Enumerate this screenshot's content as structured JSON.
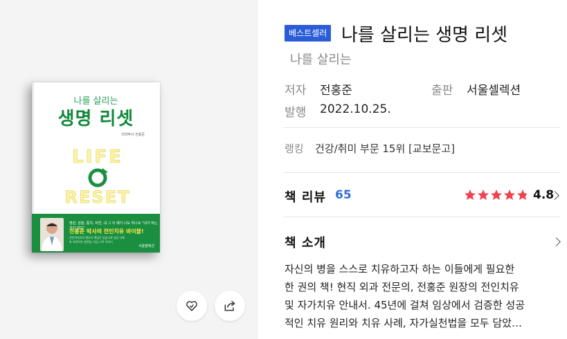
{
  "cover": {
    "subtitle": "나를 살리는",
    "title": "생명 리셋",
    "author": "의학박사 전홍준",
    "graphic_words": [
      "LIFE",
      "RESET"
    ],
    "band_intro": "영원, 암을, 통치, 자연, 내 그 이 얘기 나도 하나요 \"내가 하는 것이 쉽다\"",
    "band_headline": "전홍준 박사의 전인치유 바이블!",
    "band_detail": "전인적치유의 열쇠가 해답은 있습니까 임상 사례와 자연치유 실천법, 지금 시작 이야기",
    "publisher": "서울셀렉션"
  },
  "actions": {
    "like_icon": "heart-icon",
    "share_icon": "share-icon"
  },
  "product": {
    "badge": "베스트셀러",
    "title": "나를 살리는 생명 리셋",
    "subtitle": "나를 살리는",
    "author_label": "저자",
    "author": "전홍준",
    "publisher_label": "출판",
    "publisher": "서울셀렉션",
    "date_label": "발행",
    "date": "2022.10.25.",
    "ranking_label": "랭킹",
    "ranking": "건강/취미 부문 15위 [교보문고]"
  },
  "review": {
    "label": "책 리뷰",
    "count": "65",
    "rating": "4.8",
    "stars": 4.8,
    "star_color": "#f0434f"
  },
  "introduction": {
    "label": "책 소개",
    "lines": [
      "자신의 병을 스스로 치유하고자 하는 이들에게 필요한",
      "한 권의 책! 현직 외과 전문의, 전홍준 원장의 전인치유",
      "및 자가치유 안내서. 45년에 걸쳐 임상에서 검증한 성공",
      "적인 치유 원리와 치유 사례, 자가실천법을 모두 담았…"
    ]
  },
  "colors": {
    "accent_blue": "#2b5dd9",
    "brand_green": "#1a8f3f"
  }
}
